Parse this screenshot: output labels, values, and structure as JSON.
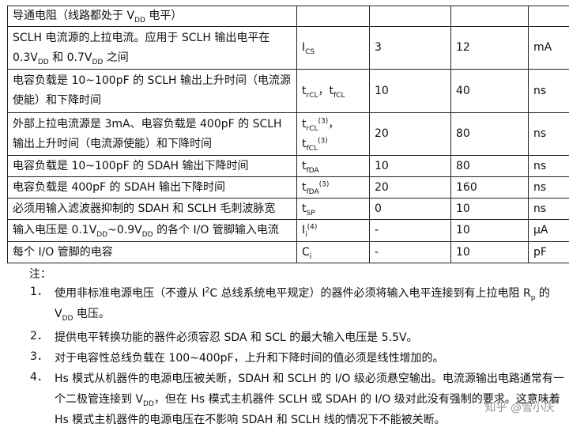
{
  "table": {
    "rows": [
      {
        "desc": "导通电阻（线路都处于 V<sub>DD</sub> 电平）",
        "sym": "",
        "min": "",
        "max": "",
        "unit": ""
      },
      {
        "desc": "SCLH 电流源的上拉电流。应用于 SCLH 输出电平在 0.3V<sub>DD</sub> 和 0.7V<sub>DD</sub> 之间",
        "sym": "I<sub>CS</sub>",
        "min": "3",
        "max": "12",
        "unit": "mA"
      },
      {
        "desc": "电容负载是 10~100pF 的 SCLH 输出上升时间（电流源使能）和下降时间",
        "sym": "t<sub>rCL</sub>，t<sub>fCL</sub>",
        "min": "10",
        "max": "40",
        "unit": "ns"
      },
      {
        "desc": "外部上拉电流源是 3mA、电容负载是 400pF 的 SCLH 输出上升时间（电流源使能）和下降时间",
        "sym": "t<sub>rCL</sub><sup>(3)</sup>，t<sub>fCL</sub><sup>(3)</sup>",
        "min": "20",
        "max": "80",
        "unit": "ns"
      },
      {
        "desc": "电容负载是 10~100pF 的 SDAH 输出下降时间",
        "sym": "t<sub>fDA</sub>",
        "min": "10",
        "max": "80",
        "unit": "ns"
      },
      {
        "desc": "电容负载是 400pF 的 SDAH 输出下降时间",
        "sym": "t<sub>fDA</sub><sup>(3)</sup>",
        "min": "20",
        "max": "160",
        "unit": "ns"
      },
      {
        "desc": "必须用输入滤波器抑制的 SDAH 和 SCLH 毛刺波脉宽",
        "sym": "t<sub>SP</sub>",
        "min": "0",
        "max": "10",
        "unit": "ns"
      },
      {
        "desc": "输入电压是 0.1V<sub>DD</sub>~0.9V<sub>DD</sub> 的各个 I/O 管脚输入电流",
        "sym": "I<sub>i</sub><sup>(4)</sup>",
        "min": "-",
        "max": "10",
        "unit": "μA"
      },
      {
        "desc": "每个 I/O 管脚的电容",
        "sym": "C<sub>i</sub>",
        "min": "-",
        "max": "10",
        "unit": "pF"
      }
    ]
  },
  "notes": {
    "heading": "注：",
    "items": [
      {
        "num": "1．",
        "text": "使用非标准电源电压（不遵从 I<sup>2</sup>C 总线系统电平规定）的器件必须将输入电平连接到有上拉电阻 R<sub>p</sub> 的 V<sub>DD</sub> 电压。"
      },
      {
        "num": "2．",
        "text": "提供电平转换功能的器件必须容忍 SDA 和 SCL 的最大输入电压是 5.5V。"
      },
      {
        "num": "3．",
        "text": "对于电容性总线负载在 100~400pF，上升和下降时间的值必须是线性增加的。"
      },
      {
        "num": "4．",
        "text": "Hs 模式从机器件的电源电压被关断，SDAH 和 SCLH 的 I/O 级必须悬空输出。电流源输出电路通常有一个二极管连接到 V<sub>DD</sub>，但在 Hs 模式主机器件 SCLH 或 SDAH 的 I/O 级对此没有强制的要求。这意味着 Hs 模式主机器件的电源电压在不影响 SDAH 和 SCLH 线的情况下不能被关断。"
      }
    ]
  },
  "watermark": "知乎 @雪小庆"
}
